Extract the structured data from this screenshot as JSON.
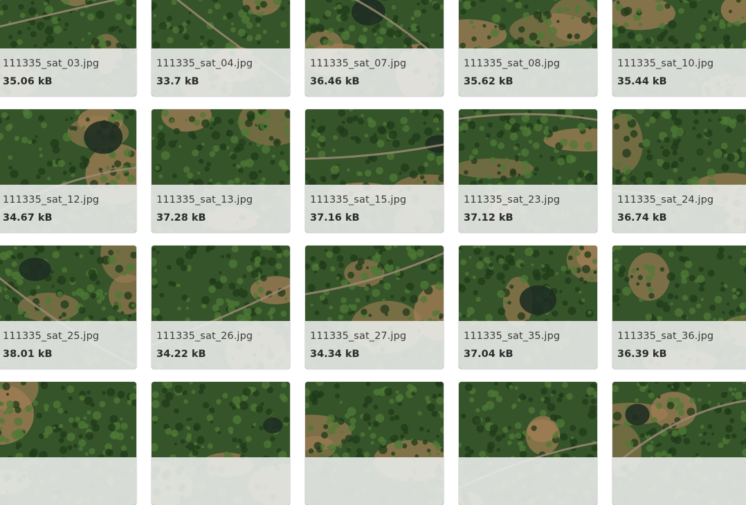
{
  "gallery": {
    "items": [
      {
        "name": "111335_sat_03.jpg",
        "size": "35.06 kB",
        "thumbnail": "satellite-image"
      },
      {
        "name": "111335_sat_04.jpg",
        "size": "33.7 kB",
        "thumbnail": "satellite-image"
      },
      {
        "name": "111335_sat_07.jpg",
        "size": "36.46 kB",
        "thumbnail": "satellite-image"
      },
      {
        "name": "111335_sat_08.jpg",
        "size": "35.62 kB",
        "thumbnail": "satellite-image"
      },
      {
        "name": "111335_sat_10.jpg",
        "size": "35.44 kB",
        "thumbnail": "satellite-image"
      },
      {
        "name": "111335_sat_12.jpg",
        "size": "34.67 kB",
        "thumbnail": "satellite-image"
      },
      {
        "name": "111335_sat_13.jpg",
        "size": "37.28 kB",
        "thumbnail": "satellite-image"
      },
      {
        "name": "111335_sat_15.jpg",
        "size": "37.16 kB",
        "thumbnail": "satellite-image"
      },
      {
        "name": "111335_sat_23.jpg",
        "size": "37.12 kB",
        "thumbnail": "satellite-image"
      },
      {
        "name": "111335_sat_24.jpg",
        "size": "36.74 kB",
        "thumbnail": "satellite-image"
      },
      {
        "name": "111335_sat_25.jpg",
        "size": "38.01 kB",
        "thumbnail": "satellite-image"
      },
      {
        "name": "111335_sat_26.jpg",
        "size": "34.22 kB",
        "thumbnail": "satellite-image"
      },
      {
        "name": "111335_sat_27.jpg",
        "size": "34.34 kB",
        "thumbnail": "satellite-image"
      },
      {
        "name": "111335_sat_35.jpg",
        "size": "37.04 kB",
        "thumbnail": "satellite-image"
      },
      {
        "name": "111335_sat_36.jpg",
        "size": "36.39 kB",
        "thumbnail": "satellite-image"
      },
      {
        "name": "",
        "size": "",
        "thumbnail": "satellite-image"
      },
      {
        "name": "",
        "size": "",
        "thumbnail": "satellite-image"
      },
      {
        "name": "",
        "size": "",
        "thumbnail": "satellite-image"
      },
      {
        "name": "",
        "size": "",
        "thumbnail": "satellite-image"
      },
      {
        "name": "",
        "size": "",
        "thumbnail": "satellite-image"
      }
    ]
  },
  "colors": {
    "forest": "#35542a",
    "forest_dark": "#1f3a18",
    "forest_light": "#4f7a36",
    "soil": "#a07d55",
    "road": "#9c8a74",
    "water": "#1e2d22",
    "caption_bg": "#e8eae8"
  }
}
